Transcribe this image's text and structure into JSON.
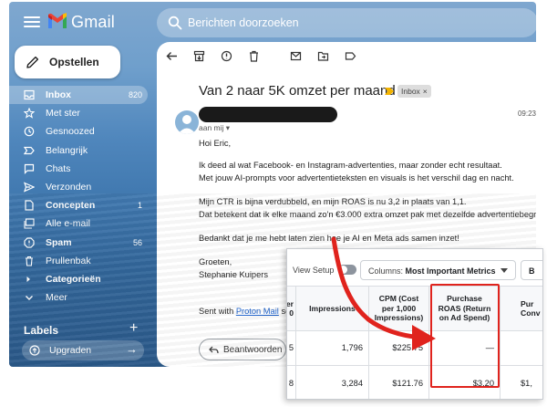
{
  "app": {
    "logo_text": "Gmail",
    "search_placeholder": "Berichten doorzoeken",
    "compose_label": "Opstellen"
  },
  "sidebar": {
    "items": [
      {
        "label": "Inbox",
        "count": "820",
        "icon": "inbox-icon",
        "active": true
      },
      {
        "label": "Met ster",
        "count": "",
        "icon": "star-icon"
      },
      {
        "label": "Gesnoozed",
        "count": "",
        "icon": "clock-icon"
      },
      {
        "label": "Belangrijk",
        "count": "",
        "icon": "important-icon"
      },
      {
        "label": "Chats",
        "count": "",
        "icon": "chat-icon"
      },
      {
        "label": "Verzonden",
        "count": "",
        "icon": "send-icon"
      },
      {
        "label": "Concepten",
        "count": "1",
        "icon": "draft-icon",
        "bold": true
      },
      {
        "label": "Alle e-mail",
        "count": "",
        "icon": "all-mail-icon"
      },
      {
        "label": "Spam",
        "count": "56",
        "icon": "spam-icon",
        "bold": true
      },
      {
        "label": "Prullenbak",
        "count": "",
        "icon": "trash-icon"
      },
      {
        "label": "Categorieën",
        "count": "",
        "icon": "category-icon",
        "bold": true
      },
      {
        "label": "Meer",
        "count": "",
        "icon": "chevron-down-icon"
      }
    ],
    "labels_title": "Labels",
    "labels_add": "+",
    "upgrade_label": "Upgraden"
  },
  "mail": {
    "subject": "Van 2 naar 5K omzet per maand",
    "inbox_chip": "Inbox",
    "chip_close": "×",
    "to_me": "aan mij",
    "time": "09:23",
    "body": [
      "Hoi Eric,",
      "Ik deed al wat Facebook- en Instagram-advertenties, maar zonder echt resultaat.",
      "Met jouw AI-prompts voor advertentieteksten en visuals is het verschil dag en nacht.",
      "Mijn CTR is bijna verdubbeld, en mijn ROAS is nu 3,2 in plaats van 1,1.",
      "Dat betekent dat ik elke maand zo'n €3.000 extra omzet pak met dezelfde advertentiebegroting.",
      "Bedankt dat je me hebt laten zien hoe je AI en Meta ads samen inzet!",
      "Groeten,",
      "Stephanie Kuipers"
    ],
    "sent_with_prefix": "Sent with ",
    "sent_with_link": "Proton Mail",
    "sent_with_suffix": " sec",
    "reply_label": "Beantwoorden"
  },
  "ads": {
    "view_setup": "View Setup",
    "columns_label": "Columns: ",
    "columns_value": "Most Important Metrics",
    "b_button": "B",
    "headers": {
      "partial_left_1": "er",
      "partial_left_2": "0",
      "impressions": "Impressions",
      "cpm_1": "CPM (Cost",
      "cpm_2": "per 1,000",
      "cpm_3": "Impressions)",
      "roas_1": "Purchase",
      "roas_2": "ROAS (Return",
      "roas_3": "on Ad Spend)",
      "partial_right_1": "Pur",
      "partial_right_2": "Conv"
    },
    "rows": [
      {
        "partial": "5",
        "impressions": "1,796",
        "cpm": "$225.75",
        "roas": "—",
        "right": ""
      },
      {
        "partial": "8",
        "impressions": "3,284",
        "cpm": "$121.76",
        "roas": "$3.20",
        "right": "$1,"
      }
    ]
  },
  "colors": {
    "highlight": "#e0231d",
    "link": "#1a5fc9"
  }
}
